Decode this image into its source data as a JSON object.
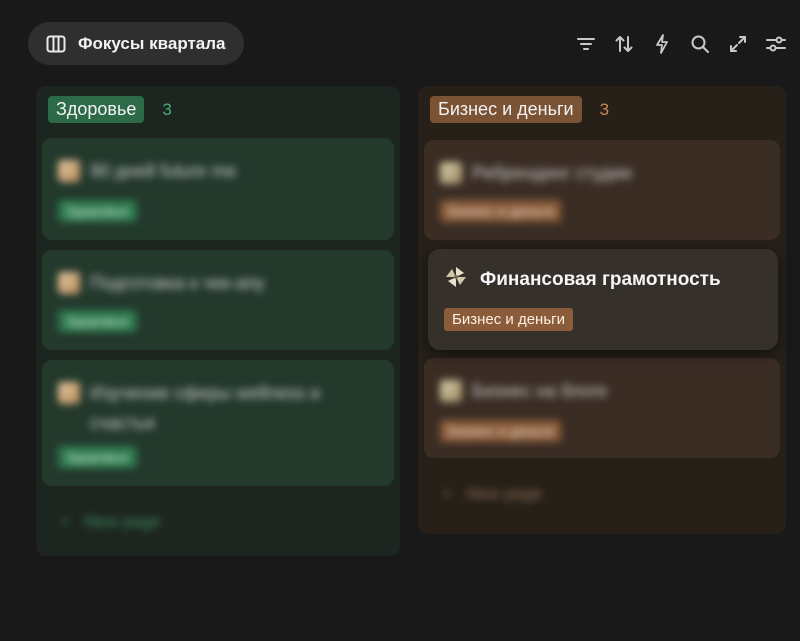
{
  "view": {
    "title": "Фокусы квартала",
    "icon": "columns-icon"
  },
  "toolbar": {
    "tools": [
      "filter-icon",
      "sort-icon",
      "lightning-icon",
      "search-icon",
      "expand-icon",
      "settings-sliders-icon"
    ]
  },
  "columns": [
    {
      "label": "Здоровье",
      "count": "3",
      "color": "#2d6a47",
      "cards": [
        {
          "title": "90 дней future me",
          "tag": "Здоровье",
          "icon": "flexed-arm-icon"
        },
        {
          "title": "Подготовка к чек-апу",
          "tag": "Здоровье",
          "icon": "flexed-arm-icon"
        },
        {
          "title": "Изучение сферы wellness и счастья",
          "tag": "Здоровье",
          "icon": "flexed-arm-icon"
        }
      ],
      "new_page": "New page"
    },
    {
      "label": "Бизнес и деньги",
      "count": "3",
      "color": "#7a5234",
      "cards": [
        {
          "title": "Ребрендинг студии",
          "tag": "Бизнес и деньги",
          "icon": "scroll-icon"
        },
        {
          "title": "Финансовая грамотность",
          "tag": "Бизнес и деньги",
          "icon": "pinwheel-icon"
        },
        {
          "title": "Бизнес на блоге",
          "tag": "Бизнес и деньги",
          "icon": "scroll-icon"
        }
      ],
      "new_page": "New page"
    }
  ]
}
